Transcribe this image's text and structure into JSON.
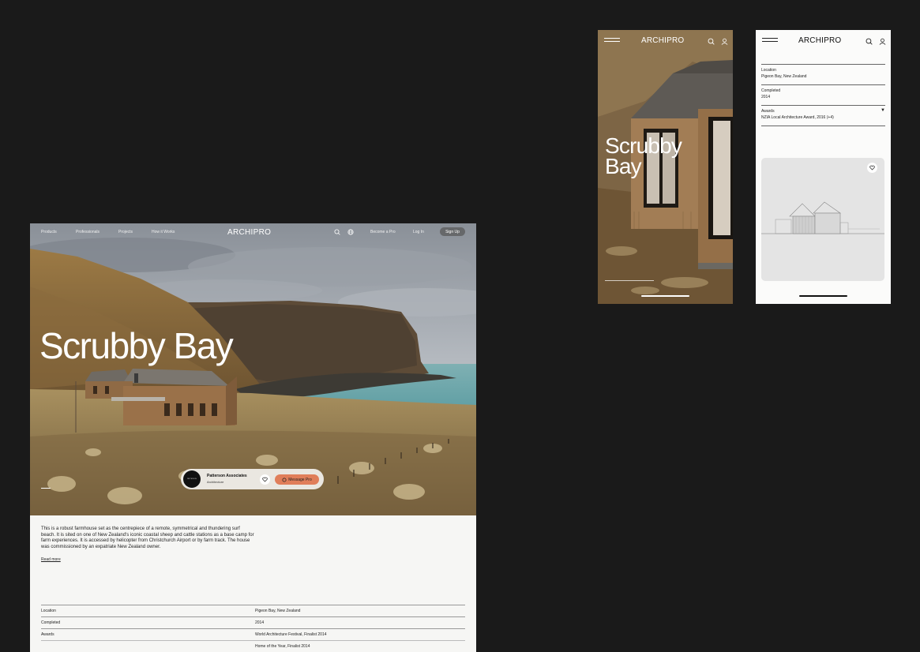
{
  "brand": "ARCHIPRO",
  "desktop": {
    "nav": {
      "products": "Products",
      "professionals": "Professionals",
      "projects": "Projects",
      "how_it_works": "How it Works",
      "become_pro": "Become a Pro",
      "login": "Log In",
      "signup": "Sign Up"
    },
    "title": "Scrubby Bay",
    "professional": {
      "avatar_text": "PATTERSON",
      "name": "Patterson Associates",
      "type": "Architecture",
      "message_label": "Message Pro"
    },
    "description": "This is a robust farmhouse set as the centrepiece of a remote, symmetrical and thundering surf beach. It is sited on one of New Zealand's iconic coastal sheep and cattle stations as a base camp for farm experiences. It is accessed by helicopter from Christchurch Airport or by farm track. The house was commissioned by an expatriate New Zealand owner.",
    "read_more": "Read more",
    "specs": [
      {
        "label": "Location",
        "value": "Pigeon Bay, New Zealand"
      },
      {
        "label": "Completed",
        "value": "2014"
      },
      {
        "label": "Awards",
        "value": "World Architecture Festival, Finalist 2014"
      },
      {
        "label": "",
        "value": "Home of the Year, Finalist 2014"
      }
    ]
  },
  "mobile_hero": {
    "title": "Scrubby Bay"
  },
  "mobile_details": {
    "location_label": "Location",
    "location_value": "Pigeon Bay, New Zealand",
    "completed_label": "Completed",
    "completed_value": "2014",
    "awards_label": "Awards",
    "awards_value": "NZIA Local Architecture Award, 2016 (+4)",
    "awards_arrow": "▼"
  },
  "colors": {
    "background": "#1a1a1a",
    "accent": "#e07e5a"
  }
}
